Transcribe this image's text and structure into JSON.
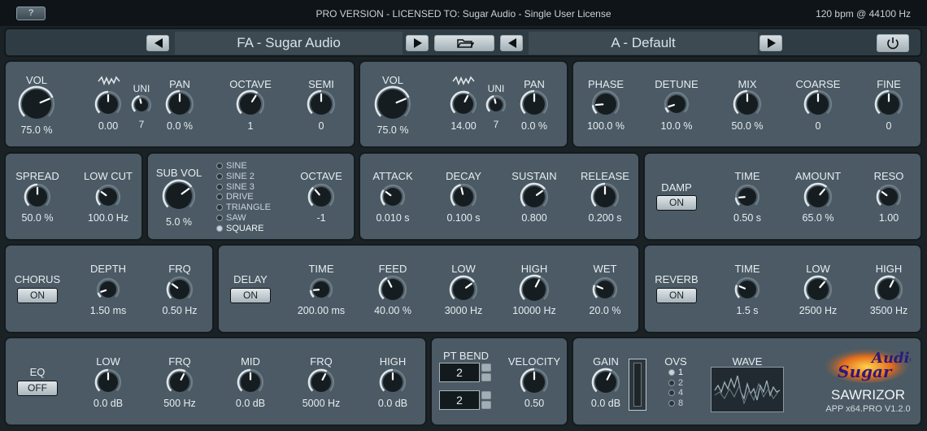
{
  "topbar": {
    "help_label": "?",
    "license_text": "PRO VERSION - LICENSED TO: Sugar Audio - Single User License",
    "bpm_text": "120 bpm @ 44100 Hz"
  },
  "presets": {
    "bank_name": "FA - Sugar Audio",
    "preset_name": "A - Default"
  },
  "osc1": {
    "vol": {
      "label": "VOL",
      "value": "75.0 %",
      "level": 0.75
    },
    "wave": {
      "value": "0.00",
      "level": 0.5,
      "icon": "waveform-icon"
    },
    "uni": {
      "label": "UNI",
      "value": "7",
      "level": 0.45
    },
    "pan": {
      "label": "PAN",
      "value": "0.0 %",
      "level": 0.5
    },
    "octave": {
      "label": "OCTAVE",
      "value": "1",
      "level": 0.62
    },
    "semi": {
      "label": "SEMI",
      "value": "0",
      "level": 0.5
    }
  },
  "osc2": {
    "vol": {
      "label": "VOL",
      "value": "75.0 %",
      "level": 0.75
    },
    "wave": {
      "value": "14.00",
      "level": 0.6,
      "icon": "waveform-icon"
    },
    "uni": {
      "label": "UNI",
      "value": "7",
      "level": 0.45
    },
    "pan": {
      "label": "PAN",
      "value": "0.0 %",
      "level": 0.5
    }
  },
  "osc_mix": {
    "phase": {
      "label": "PHASE",
      "value": "100.0 %",
      "level": 0.15
    },
    "detune": {
      "label": "DETUNE",
      "value": "10.0 %",
      "level": 0.1
    },
    "mix": {
      "label": "MIX",
      "value": "50.0 %",
      "level": 0.5
    },
    "coarse": {
      "label": "COARSE",
      "value": "0",
      "level": 0.5
    },
    "fine": {
      "label": "FINE",
      "value": "0",
      "level": 0.5
    }
  },
  "unison": {
    "spread": {
      "label": "SPREAD",
      "value": "50.0 %",
      "level": 0.5
    },
    "lowcut": {
      "label": "LOW CUT",
      "value": "100.0 Hz",
      "level": 0.3
    }
  },
  "sub": {
    "vol": {
      "label": "SUB VOL",
      "value": "5.0 %",
      "level": 0.7
    },
    "octave": {
      "label": "OCTAVE",
      "value": "-1",
      "level": 0.35
    },
    "waves": [
      "SINE",
      "SINE 2",
      "SINE 3",
      "DRIVE",
      "TRIANGLE",
      "SAW",
      "SQUARE"
    ],
    "selected": "SQUARE"
  },
  "envelope": {
    "attack": {
      "label": "ATTACK",
      "value": "0.010 s",
      "level": 0.3
    },
    "decay": {
      "label": "DECAY",
      "value": "0.100 s",
      "level": 0.45
    },
    "sustain": {
      "label": "SUSTAIN",
      "value": "0.800",
      "level": 0.7
    },
    "release": {
      "label": "RELEASE",
      "value": "0.200 s",
      "level": 0.5
    }
  },
  "filter": {
    "damp": {
      "label": "DAMP",
      "state": "ON"
    },
    "time": {
      "label": "TIME",
      "value": "0.50 s",
      "level": 0.15
    },
    "amount": {
      "label": "AMOUNT",
      "value": "65.0 %",
      "level": 0.65
    },
    "reso": {
      "label": "RESO",
      "value": "1.00",
      "level": 0.3
    }
  },
  "chorus": {
    "toggle": {
      "label": "CHORUS",
      "state": "ON"
    },
    "depth": {
      "label": "DEPTH",
      "value": "1.50 ms",
      "level": 0.1
    },
    "frq": {
      "label": "FRQ",
      "value": "0.50 Hz",
      "level": 0.3
    }
  },
  "delay": {
    "toggle": {
      "label": "DELAY",
      "state": "ON"
    },
    "time": {
      "label": "TIME",
      "value": "200.00 ms",
      "level": 0.15
    },
    "feed": {
      "label": "FEED",
      "value": "40.00 %",
      "level": 0.4
    },
    "low": {
      "label": "LOW",
      "value": "3000 Hz",
      "level": 0.7
    },
    "high": {
      "label": "HIGH",
      "value": "10000 Hz",
      "level": 0.6
    },
    "wet": {
      "label": "WET",
      "value": "20.0 %",
      "level": 0.25
    }
  },
  "reverb": {
    "toggle": {
      "label": "REVERB",
      "state": "ON"
    },
    "time": {
      "label": "TIME",
      "value": "1.5 s",
      "level": 0.25
    },
    "low": {
      "label": "LOW",
      "value": "2500 Hz",
      "level": 0.65
    },
    "high": {
      "label": "HIGH",
      "value": "3500 Hz",
      "level": 0.6
    }
  },
  "eq": {
    "toggle": {
      "label": "EQ",
      "state": "OFF"
    },
    "low": {
      "label": "LOW",
      "value": "0.0 dB",
      "level": 0.5
    },
    "frq1": {
      "label": "FRQ",
      "value": "500 Hz",
      "level": 0.6
    },
    "mid": {
      "label": "MID",
      "value": "0.0 dB",
      "level": 0.5
    },
    "frq2": {
      "label": "FRQ",
      "value": "5000 Hz",
      "level": 0.6
    },
    "high": {
      "label": "HIGH",
      "value": "0.0 dB",
      "level": 0.5
    }
  },
  "pitch": {
    "ptbend_label": "PT BEND",
    "ptbend_up": "2",
    "ptbend_down": "2",
    "velocity": {
      "label": "VELOCITY",
      "value": "0.50",
      "level": 0.5
    }
  },
  "output": {
    "gain": {
      "label": "GAIN",
      "value": "0.0 dB",
      "level": 0.6
    },
    "ovs_label": "OVS",
    "ovs_options": [
      "1",
      "2",
      "4",
      "8"
    ],
    "ovs_selected": "1",
    "wave_label": "WAVE"
  },
  "brand": {
    "logo_text": "Audio Sugar",
    "app_name": "SAWRIZOR",
    "app_version": "APP x64.PRO V1.2.0"
  },
  "colors": {
    "panel": "#4b5a64",
    "knob_body": "#161d21",
    "knob_ring": "#dfe6ea",
    "indicator": "#ffffff"
  }
}
